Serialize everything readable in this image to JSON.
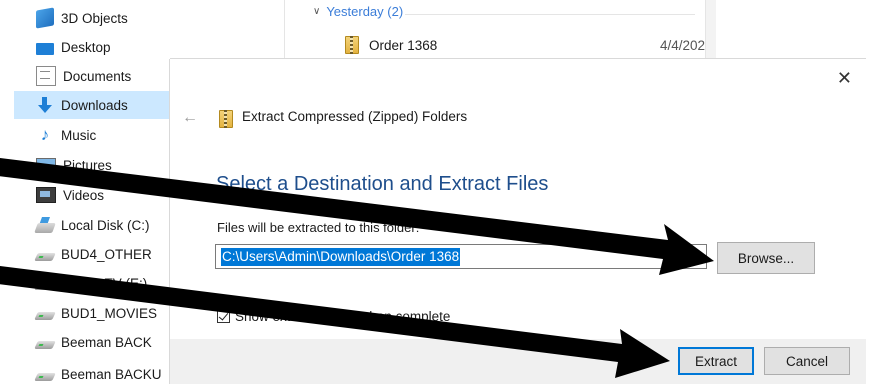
{
  "nav": {
    "items": [
      {
        "label": "3D Objects",
        "icon": "3d-objects-icon"
      },
      {
        "label": "Desktop",
        "icon": "desktop-icon"
      },
      {
        "label": "Documents",
        "icon": "documents-icon"
      },
      {
        "label": "Downloads",
        "icon": "downloads-icon",
        "selected": true
      },
      {
        "label": "Music",
        "icon": "music-icon"
      },
      {
        "label": "Pictures",
        "icon": "pictures-icon"
      },
      {
        "label": "Videos",
        "icon": "videos-icon"
      },
      {
        "label": "Local Disk (C:)",
        "icon": "local-disk-icon"
      },
      {
        "label": "BUD4_OTHER",
        "icon": "drive-icon"
      },
      {
        "label": "BUD2_TV (E:)",
        "icon": "drive-icon"
      },
      {
        "label": "BUD1_MOVIES",
        "icon": "drive-icon"
      },
      {
        "label": "Beeman BACK",
        "icon": "drive-icon"
      },
      {
        "label": "Beeman BACKU",
        "icon": "drive-icon"
      }
    ]
  },
  "files": {
    "group_header": "Yesterday (2)",
    "row": {
      "name": "Order 1368",
      "date": "4/4/202"
    }
  },
  "dialog": {
    "title": "Extract Compressed (Zipped) Folders",
    "heading": "Select a Destination and Extract Files",
    "path_label": "Files will be extracted to this folder:",
    "path_value": "C:\\Users\\Admin\\Downloads\\Order 1368",
    "browse_label": "Browse...",
    "checkbox_label": "Show extracted files when complete",
    "checkbox_checked": true,
    "extract_label": "Extract",
    "cancel_label": "Cancel",
    "close_glyph": "✕",
    "back_glyph": "←"
  },
  "colors": {
    "accent": "#0078d7",
    "heading": "#1e4e8c",
    "selection": "#cce8ff",
    "annotation": "#000000"
  }
}
